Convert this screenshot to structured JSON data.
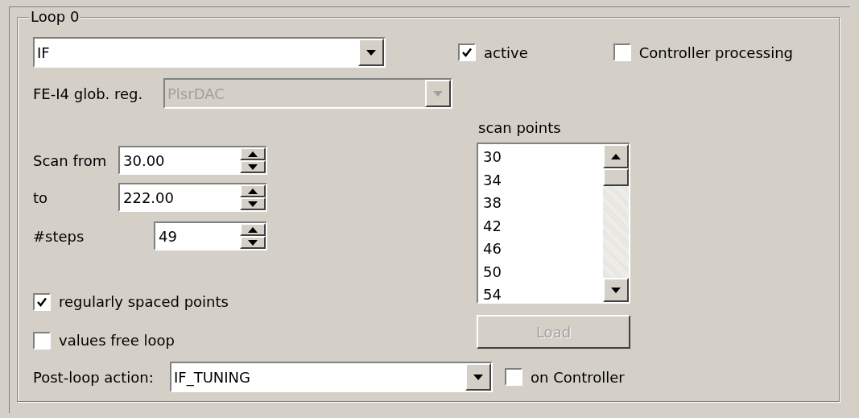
{
  "group": {
    "title": "Loop 0"
  },
  "loop_type": {
    "value": "IF"
  },
  "active": {
    "label": "active",
    "checked": true
  },
  "controller_processing": {
    "label": "Controller processing",
    "checked": false
  },
  "global_register": {
    "label": "FE-I4 glob. reg.",
    "value": "PlsrDAC",
    "disabled": true
  },
  "scan_from": {
    "label": "Scan from",
    "value": "30.00"
  },
  "scan_to": {
    "label": "to",
    "value": "222.00"
  },
  "steps": {
    "label": "#steps",
    "value": "49"
  },
  "regularly_spaced": {
    "label": "regularly spaced points",
    "checked": true
  },
  "values_free_loop": {
    "label": "values free loop",
    "checked": false
  },
  "scan_points": {
    "label": "scan points",
    "items": [
      "30",
      "34",
      "38",
      "42",
      "46",
      "50",
      "54"
    ]
  },
  "load_button": {
    "label": "Load",
    "disabled": true
  },
  "post_loop_action": {
    "label": "Post-loop action:",
    "value": "IF_TUNING"
  },
  "on_controller": {
    "label": "on Controller",
    "checked": false
  }
}
